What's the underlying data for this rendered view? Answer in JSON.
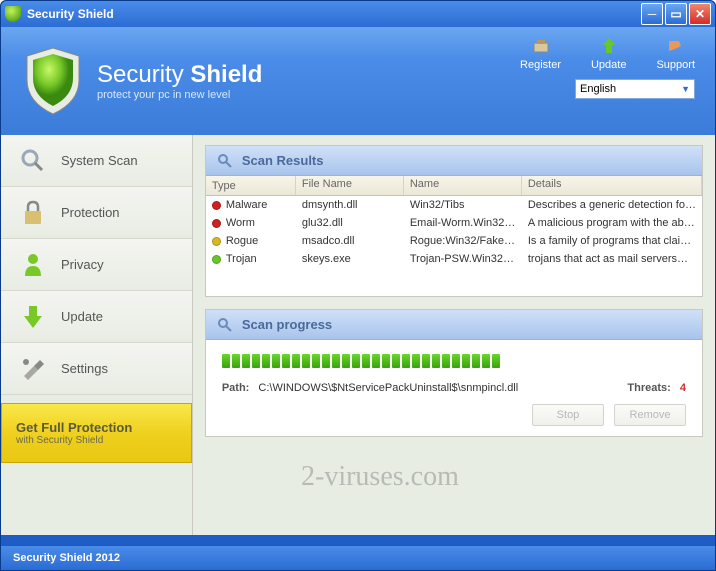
{
  "window": {
    "title": "Security Shield"
  },
  "header": {
    "brand_primary": "Security",
    "brand_secondary": "Shield",
    "tagline": "protect your pc in new level",
    "actions": {
      "register": "Register",
      "update": "Update",
      "support": "Support"
    },
    "language": "English"
  },
  "sidebar": {
    "items": [
      {
        "label": "System Scan",
        "icon": "magnifier"
      },
      {
        "label": "Protection",
        "icon": "lock"
      },
      {
        "label": "Privacy",
        "icon": "person"
      },
      {
        "label": "Update",
        "icon": "arrow-down"
      },
      {
        "label": "Settings",
        "icon": "tools"
      }
    ],
    "promo": {
      "title": "Get Full Protection",
      "subtitle": "with Security Shield"
    }
  },
  "results": {
    "title": "Scan Results",
    "columns": [
      "Type",
      "File Name",
      "Name",
      "Details"
    ],
    "rows": [
      {
        "color": "#d02020",
        "type": "Malware",
        "file": "dmsynth.dll",
        "name": "Win32/Tibs",
        "details": "Describes a generic detection fo…"
      },
      {
        "color": "#d02020",
        "type": "Worm",
        "file": "glu32.dll",
        "name": "Email-Worm.Win32…",
        "details": "A malicious program with the ab…"
      },
      {
        "color": "#d8b820",
        "type": "Rogue",
        "file": "msadco.dll",
        "name": "Rogue:Win32/Fake5…",
        "details": "Is a family of programs that clai…"
      },
      {
        "color": "#68c828",
        "type": "Trojan",
        "file": "skeys.exe",
        "name": "Trojan-PSW.Win32.…",
        "details": "trojans that act as mail servers…"
      }
    ]
  },
  "progress": {
    "title": "Scan progress",
    "segments": 28,
    "path_label": "Path:",
    "path_value": "C:\\WINDOWS\\$NtServicePackUninstall$\\snmpincl.dll",
    "threats_label": "Threats:",
    "threats_value": "4",
    "stop_btn": "Stop",
    "remove_btn": "Remove"
  },
  "statusbar": "Security Shield 2012",
  "watermark": "2-viruses.com"
}
